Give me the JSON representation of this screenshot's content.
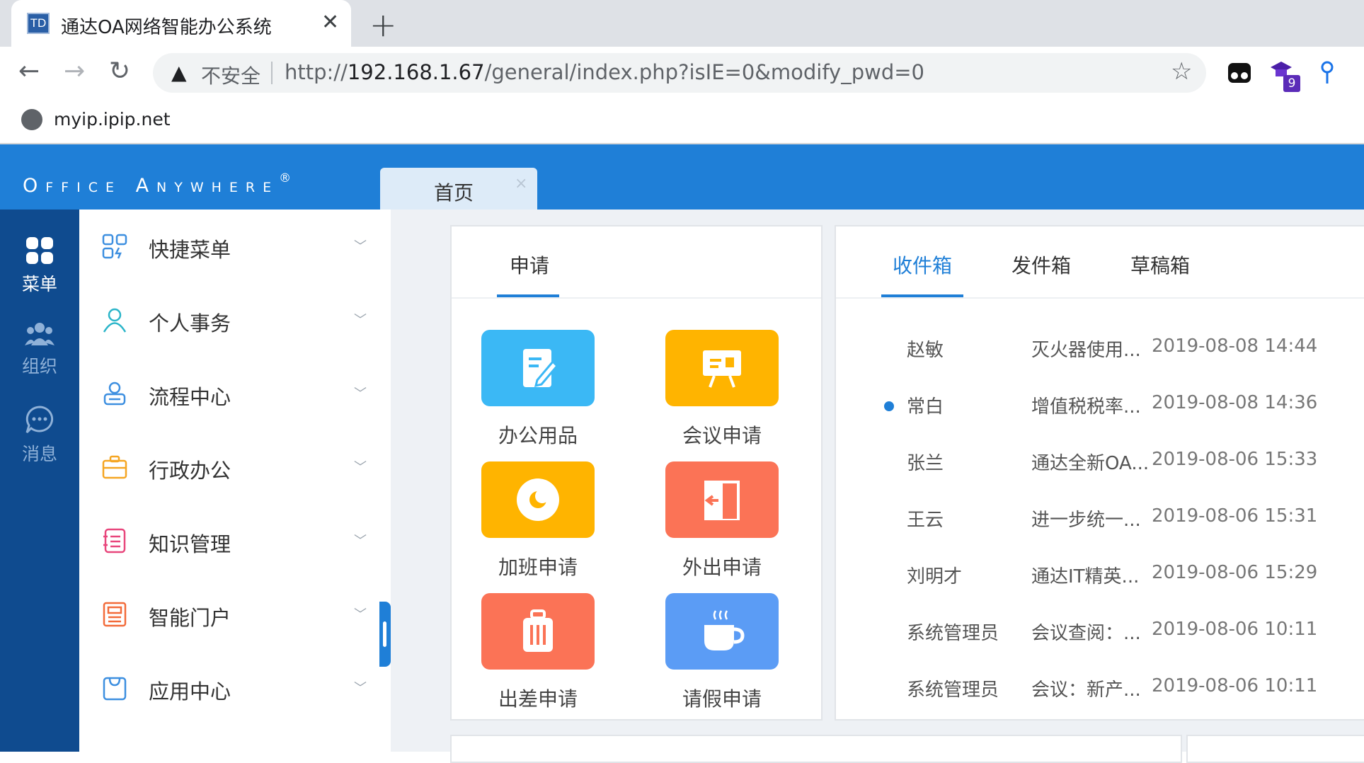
{
  "browser": {
    "tab_title": "通达OA网络智能办公系统",
    "tab_favicon": "TD",
    "tab_close": "✕",
    "new_tab": "+",
    "security_label": "不安全",
    "url_prefix": "http://",
    "url_host": "192.168.1.67",
    "url_path": "/general/index.php?isIE=0&modify_pwd=0",
    "extension_badge": "9",
    "bookmark_label": "myip.ipip.net"
  },
  "app": {
    "brand": "Office Anywhere",
    "brand_mark": "®",
    "open_tab": "首页",
    "open_tab_close": "×"
  },
  "rail": [
    {
      "label": "菜单",
      "icon": "apps-grid-icon",
      "active": true
    },
    {
      "label": "组织",
      "icon": "people-icon",
      "active": false
    },
    {
      "label": "消息",
      "icon": "chat-bubble-icon",
      "active": false
    }
  ],
  "menu": [
    {
      "label": "快捷菜单",
      "icon": "quick-menu-icon",
      "color": "#3d8fe0"
    },
    {
      "label": "个人事务",
      "icon": "person-icon",
      "color": "#2bb5c9"
    },
    {
      "label": "流程中心",
      "icon": "workflow-icon",
      "color": "#3d8fe0"
    },
    {
      "label": "行政办公",
      "icon": "briefcase-icon",
      "color": "#f5a623"
    },
    {
      "label": "知识管理",
      "icon": "notebook-icon",
      "color": "#e8467c"
    },
    {
      "label": "智能门户",
      "icon": "portal-icon",
      "color": "#f26b3a"
    },
    {
      "label": "应用中心",
      "icon": "app-center-icon",
      "color": "#3d8fe0"
    }
  ],
  "apply_card": {
    "tab": "申请",
    "apps": [
      {
        "label": "办公用品",
        "icon": "office-supplies-icon",
        "color": "#3bb8f5"
      },
      {
        "label": "会议申请",
        "icon": "meeting-icon",
        "color": "#ffb400"
      },
      {
        "label": "加班申请",
        "icon": "overtime-icon",
        "color": "#ffb400"
      },
      {
        "label": "外出申请",
        "icon": "door-out-icon",
        "color": "#fb7356"
      },
      {
        "label": "出差申请",
        "icon": "luggage-icon",
        "color": "#fb7356"
      },
      {
        "label": "请假申请",
        "icon": "coffee-cup-icon",
        "color": "#5b9cf5"
      }
    ]
  },
  "mail_card": {
    "tabs": [
      "收件箱",
      "发件箱",
      "草稿箱"
    ],
    "rows": [
      {
        "from": "赵敏",
        "subject": "灭火器使用...",
        "time": "2019-08-08 14:44",
        "unread": false
      },
      {
        "from": "常白",
        "subject": "增值税税率...",
        "time": "2019-08-08 14:36",
        "unread": true
      },
      {
        "from": "张兰",
        "subject": "通达全新OA...",
        "time": "2019-08-06 15:33",
        "unread": false
      },
      {
        "from": "王云",
        "subject": "进一步统一...",
        "time": "2019-08-06 15:31",
        "unread": false
      },
      {
        "from": "刘明才",
        "subject": "通达IT精英...",
        "time": "2019-08-06 15:29",
        "unread": false
      },
      {
        "from": "系统管理员",
        "subject": "会议查阅：...",
        "time": "2019-08-06 10:11",
        "unread": false
      },
      {
        "from": "系统管理员",
        "subject": "会议：新产...",
        "time": "2019-08-06 10:11",
        "unread": false
      }
    ]
  }
}
